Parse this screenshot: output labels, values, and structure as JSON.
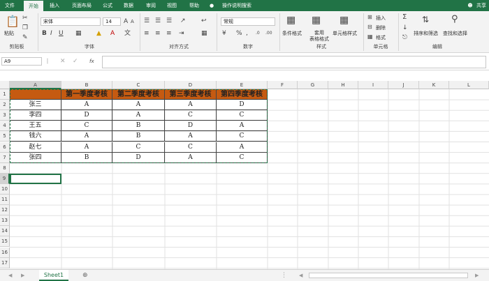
{
  "tabs": [
    "文件",
    "开始",
    "插入",
    "页面布局",
    "公式",
    "数据",
    "审阅",
    "视图",
    "帮助"
  ],
  "tell_me": "操作说明搜索",
  "share": "共享",
  "ribbon": {
    "clipboard": {
      "paste": "粘贴",
      "label": "剪贴板"
    },
    "font": {
      "name": "宋体",
      "size": "14",
      "label": "字体"
    },
    "alignment": {
      "label": "对齐方式"
    },
    "number": {
      "format": "常规",
      "label": "数字"
    },
    "styles": {
      "cond": "条件格式",
      "table": "套用\n表格格式",
      "cell": "单元格样式",
      "label": "样式"
    },
    "cells": {
      "insert": "插入",
      "delete": "删除",
      "format": "格式",
      "label": "单元格"
    },
    "editing": {
      "sortfilter": "排序和筛选",
      "find": "查找和选择",
      "label": "编辑"
    }
  },
  "formula_bar": {
    "name_box": "A9",
    "fx": "fx",
    "value": ""
  },
  "columns": [
    "A",
    "B",
    "C",
    "D",
    "E",
    "F",
    "G",
    "H",
    "I",
    "J",
    "K",
    "L"
  ],
  "rows": [
    "1",
    "2",
    "3",
    "4",
    "5",
    "6",
    "7",
    "8",
    "9",
    "10",
    "11",
    "12",
    "13",
    "14",
    "15",
    "16",
    "17"
  ],
  "sheet": {
    "headers": [
      "",
      "第一季度考核",
      "第二季度考核",
      "第三季度考核",
      "第四季度考核"
    ],
    "data": [
      [
        "张三",
        "A",
        "A",
        "A",
        "D"
      ],
      [
        "李四",
        "D",
        "A",
        "C",
        "C"
      ],
      [
        "王五",
        "C",
        "B",
        "D",
        "A"
      ],
      [
        "钱六",
        "A",
        "B",
        "A",
        "C"
      ],
      [
        "赵七",
        "A",
        "C",
        "C",
        "A"
      ],
      [
        "张四",
        "B",
        "D",
        "A",
        "C"
      ]
    ]
  },
  "sheet_tab": "Sheet1",
  "colors": {
    "header_fill": "#c55a11",
    "excel_green": "#217346"
  }
}
